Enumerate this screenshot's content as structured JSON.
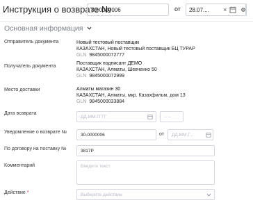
{
  "header": {
    "title": "Инструкция о возврате №",
    "doc_number": "30-0000006",
    "from_label": "от",
    "date_value": "28.07....",
    "clear_glyph": "×"
  },
  "section": {
    "title": "Основная информация"
  },
  "sender": {
    "label": "Отправитель документа",
    "line1": "Новый тестовый поставщик",
    "line2": "КАЗАХСТАН, Новый тестовый поставщик БЦ ТУРАР",
    "gln_label": "GLN",
    "gln_value": "9845000072777"
  },
  "recipient": {
    "label": "Получатель документа",
    "line1": "Поставщик подписант ДЕМО",
    "line2": "КАЗАХСТАН, Алматы, Шевченко 50",
    "gln_label": "GLN",
    "gln_value": "9845000072999"
  },
  "delivery": {
    "label": "Место доставки",
    "line1": "Алматы магазин 30",
    "line2": "КАЗАХСТАН, Алматы, мкр. Казахфильм, дом 13",
    "gln_label": "GLN",
    "gln_value": "9845000033884"
  },
  "return_date": {
    "label": "Дата возврата",
    "date_placeholder": "ДД.ММ.ГГГГ",
    "time_placeholder": "--:--"
  },
  "notice": {
    "label": "Уведомление о возврате №",
    "value": "30-0000006",
    "from_label": "от",
    "date_placeholder": "ДД.ММ.Г..."
  },
  "contract": {
    "label": "По договору на поставку №",
    "value": "3817P"
  },
  "comment": {
    "label": "Комментарий",
    "placeholder": "Введите текст"
  },
  "action": {
    "label": "Действие",
    "required_mark": "*",
    "placeholder": "Выберите действие"
  },
  "colors": {
    "border": "#cfd3da",
    "muted": "#7a7f87",
    "placeholder": "#b7bbc2",
    "required": "#e0303a"
  },
  "icons": [
    "calendar-icon",
    "clear-icon",
    "settings-icon",
    "chevron-down-icon"
  ]
}
